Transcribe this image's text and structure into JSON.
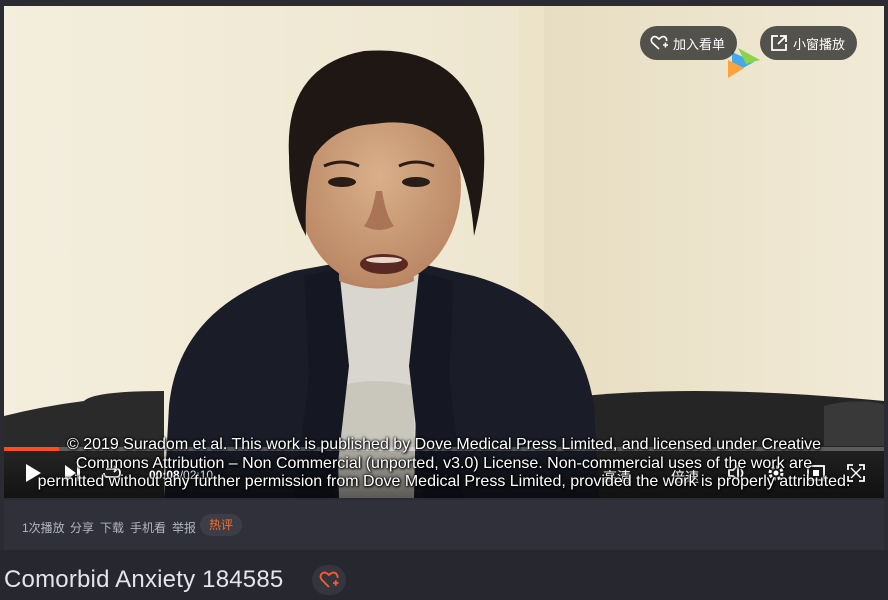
{
  "overlay": {
    "add_watchlist_label": "加入看单",
    "mini_window_label": "小窗播放"
  },
  "subtitle": {
    "line1": "© 2019 Suradom et al. This work is published by Dove Medical Press Limited, and licensed under Creative",
    "line2": "Commons Attribution – Non Commercial (unported, v3.0) License. Non-commercial uses of the work are",
    "line3": "permitted without any further permission from Dove Medical Press Limited, provided the work is properly attributed."
  },
  "controls": {
    "current_time": "00:08",
    "duration": "/02:10",
    "progress_fraction": 0.062,
    "quality_label": "高清",
    "speed_label": "倍速",
    "icons": [
      "play-icon",
      "next-icon",
      "loop-icon",
      "volume-icon",
      "settings-icon",
      "fullscreen-icon",
      "web-fullscreen-icon"
    ]
  },
  "meta": {
    "play_count": "1次播放",
    "share": "分享",
    "download": "下载",
    "mobile_watch": "手机看",
    "report": "举报",
    "hot_comments": "热评"
  },
  "video": {
    "title": "Comorbid Anxiety 184585"
  },
  "colors": {
    "accent": "#ff4d1f",
    "hot_badge_text": "#ff6a2c",
    "background": "#2a2b33"
  }
}
